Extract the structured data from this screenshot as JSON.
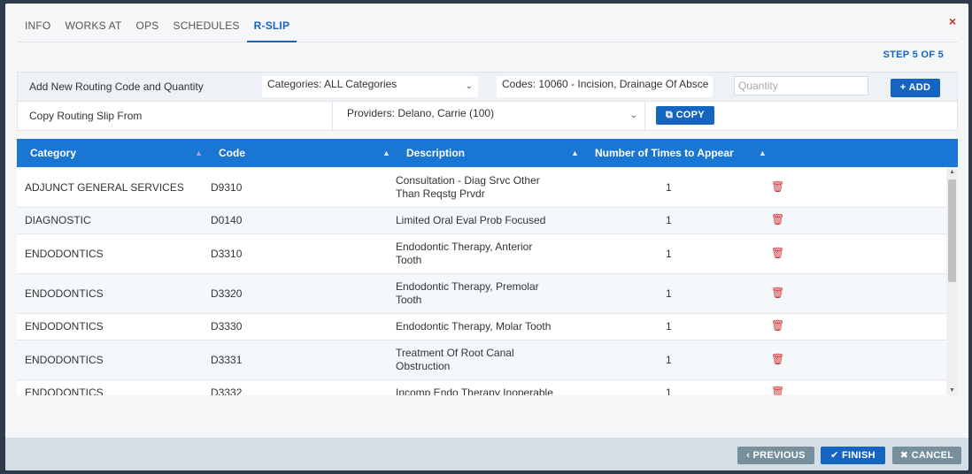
{
  "tabs": [
    "INFO",
    "WORKS AT",
    "OPS",
    "SCHEDULES",
    "R-SLIP"
  ],
  "close_label": "×",
  "step_label": "STEP 5 OF 5",
  "add_row": {
    "label": "Add New Routing Code and Quantity",
    "categories_value": "Categories: ALL Categories",
    "codes_value": "Codes: 10060 - Incision, Drainage Of Absce",
    "quantity_placeholder": "Quantity",
    "add_button": "ADD"
  },
  "copy_row": {
    "label": "Copy Routing Slip From",
    "providers_value": "Providers: Delano, Carrie (100)",
    "copy_button": "COPY"
  },
  "table": {
    "headers": [
      "Category",
      "Code",
      "Description",
      "Number of Times to Appear"
    ],
    "rows": [
      {
        "category": "ADJUNCT GENERAL SERVICES",
        "code": "D9310",
        "desc1": "Consultation - Diag Srvc Other",
        "desc2": "Than Reqstg Prvdr",
        "count": "1"
      },
      {
        "category": "DIAGNOSTIC",
        "code": "D0140",
        "desc1": "Limited Oral Eval Prob Focused",
        "desc2": "",
        "count": "1"
      },
      {
        "category": "ENDODONTICS",
        "code": "D3310",
        "desc1": "Endodontic Therapy, Anterior",
        "desc2": "Tooth",
        "count": "1"
      },
      {
        "category": "ENDODONTICS",
        "code": "D3320",
        "desc1": "Endodontic Therapy, Premolar",
        "desc2": "Tooth",
        "count": "1"
      },
      {
        "category": "ENDODONTICS",
        "code": "D3330",
        "desc1": "Endodontic Therapy, Molar Tooth",
        "desc2": "",
        "count": "1"
      },
      {
        "category": "ENDODONTICS",
        "code": "D3331",
        "desc1": "Treatment Of Root Canal",
        "desc2": "Obstruction",
        "count": "1"
      },
      {
        "category": "ENDODONTICS",
        "code": "D3332",
        "desc1": "Incomp Endo Therapy Inoperable",
        "desc2": "",
        "count": "1"
      }
    ]
  },
  "footer": {
    "previous": "PREVIOUS",
    "finish": "FINISH",
    "cancel": "CANCEL"
  },
  "colors": {
    "primary": "#1565c0",
    "header": "#1976d2",
    "danger": "#d32f2f",
    "secondary": "#78909c"
  }
}
